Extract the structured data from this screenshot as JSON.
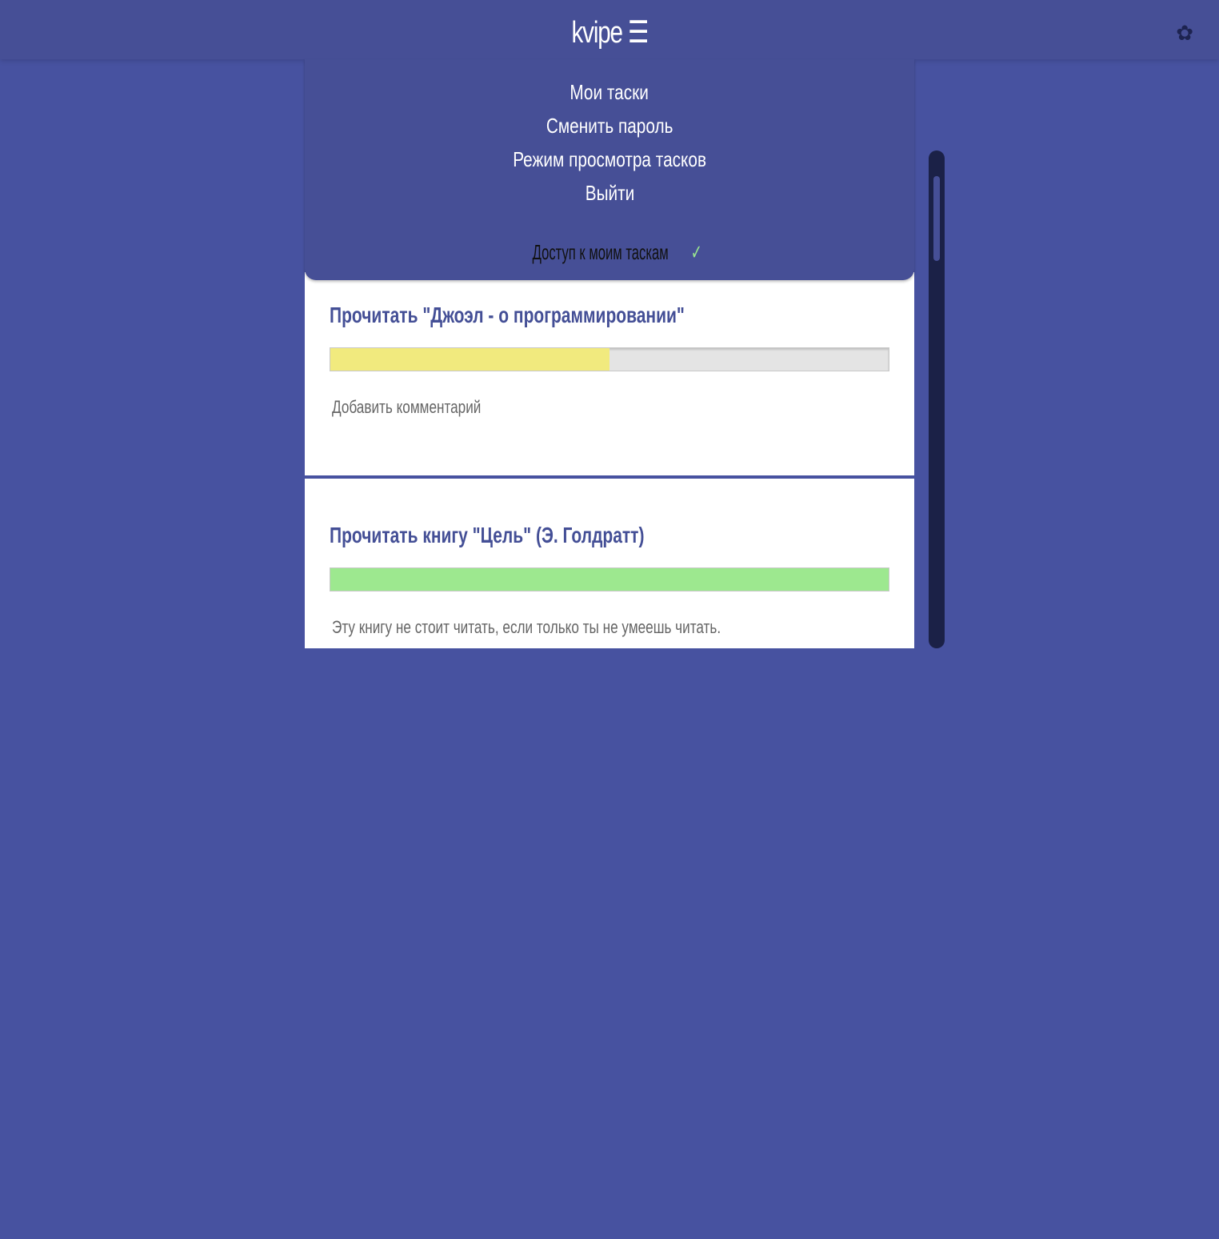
{
  "header": {
    "brand": "kvipe",
    "menu_icon": "☰",
    "settings_icon": "✿"
  },
  "menu": {
    "items": [
      "Мои таски",
      "Сменить пароль",
      "Режим просмотра тасков",
      "Выйти"
    ],
    "access_label": "Доступ к моим таскам",
    "access_icon": "✓"
  },
  "tasks": [
    {
      "title": "Прочитать \"Джоэл - о программировании\"",
      "progress": 0.5,
      "color": "#f1ea7e",
      "comment": "Добавить комментарий"
    },
    {
      "title": "Прочитать книгу \"Цель\" (Э. Голдратт)",
      "progress": 1.0,
      "color": "#9de88f",
      "comment": "Эту книгу не стоит читать, если только ты не умеешь читать."
    }
  ]
}
